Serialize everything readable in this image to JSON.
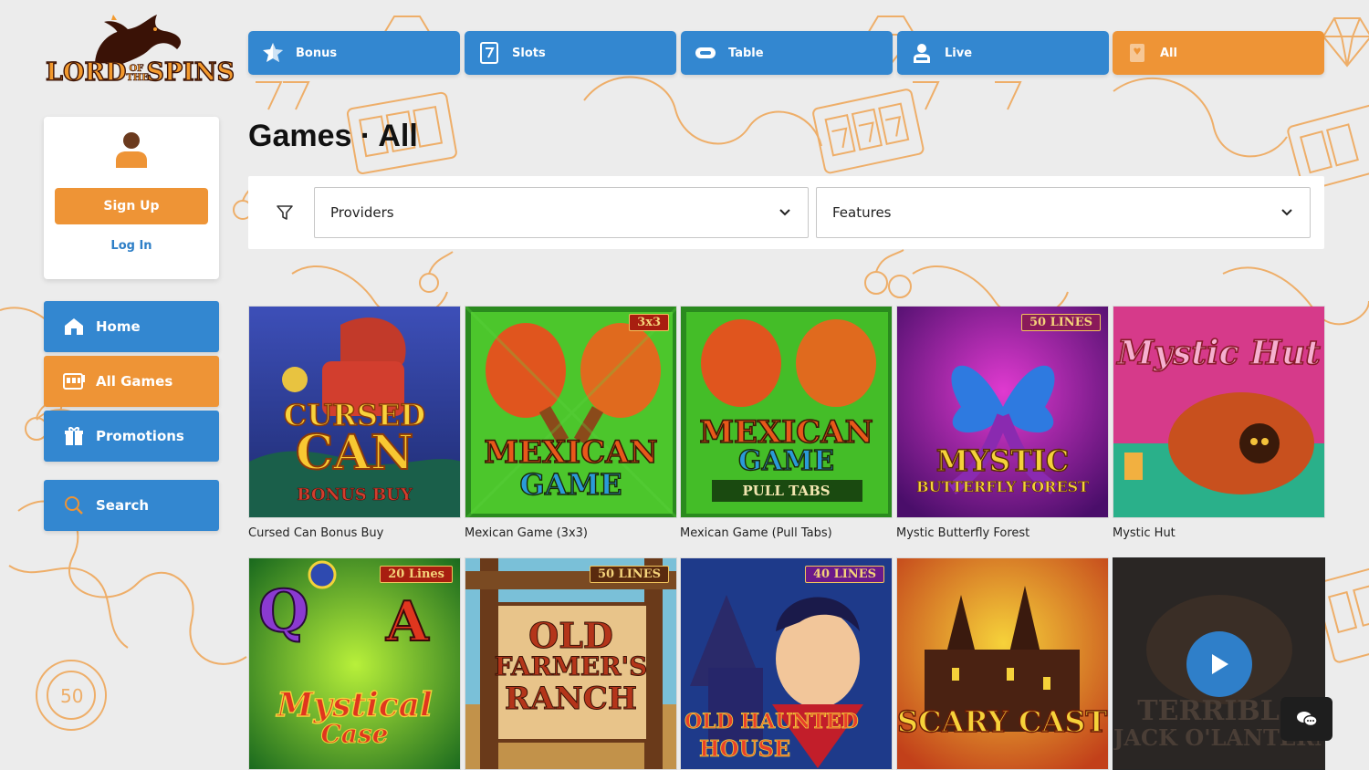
{
  "brand": {
    "logo_line1": "LORD",
    "logo_of": "OF",
    "logo_the": "THE",
    "logo_line2": "SPINS",
    "accent_orange": "#ee9436",
    "accent_blue": "#3387d0"
  },
  "user_card": {
    "signup_label": "Sign Up",
    "login_label": "Log In"
  },
  "sidebar": {
    "items": [
      {
        "label": "Home",
        "icon": "home-icon"
      },
      {
        "label": "All Games",
        "icon": "slot-machine-icon",
        "active": true
      },
      {
        "label": "Promotions",
        "icon": "gift-icon"
      },
      {
        "label": "Search",
        "icon": "search-icon"
      }
    ]
  },
  "tabs": [
    {
      "label": "Bonus",
      "icon": "star-icon"
    },
    {
      "label": "Slots",
      "icon": "slot-seven-icon"
    },
    {
      "label": "Table",
      "icon": "casino-chip-icon"
    },
    {
      "label": "Live",
      "icon": "dealer-icon"
    },
    {
      "label": "All",
      "icon": "cards-icon",
      "active": true
    }
  ],
  "page": {
    "title": "Games · All"
  },
  "filters": {
    "providers_label": "Providers",
    "features_label": "Features"
  },
  "games": [
    {
      "title": "Cursed Can Bonus Buy",
      "art_line1": "CURSED",
      "art_line2": "CAN",
      "art_line3": "BONUS BUY"
    },
    {
      "title": "Mexican Game (3x3)",
      "badge": "3x3",
      "art_line1": "MEXICAN",
      "art_line2": "GAME"
    },
    {
      "title": "Mexican Game (Pull Tabs)",
      "art_line1": "MEXICAN",
      "art_line2": "GAME",
      "art_line3": "PULL TABS"
    },
    {
      "title": "Mystic Butterfly Forest",
      "badge": "50 LINES",
      "art_line1": "MYSTIC",
      "art_line2": "BUTTERFLY FOREST"
    },
    {
      "title": "Mystic Hut",
      "art_line1": "Mystic Hut"
    },
    {
      "badge": "20 Lines",
      "art_line1": "Mystical",
      "art_line2": "Case"
    },
    {
      "badge": "50 LINES",
      "art_line1": "OLD",
      "art_line2": "FARMER'S",
      "art_line3": "RANCH"
    },
    {
      "badge": "40 LINES",
      "art_line1": "OLD HAUNTED",
      "art_line2": "HOUSE"
    },
    {
      "art_line1": "SCARY CASTLE"
    },
    {
      "art_line1": "TERRIBLE",
      "art_line2": "JACK O'LANTERN"
    }
  ]
}
